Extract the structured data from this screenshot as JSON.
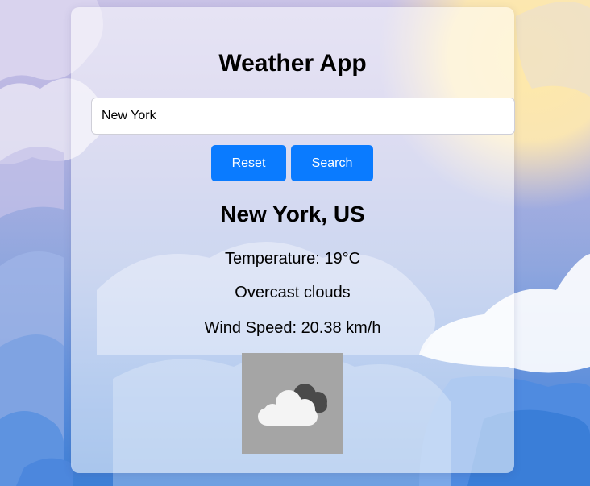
{
  "app": {
    "title": "Weather App"
  },
  "search": {
    "value": "New York"
  },
  "buttons": {
    "reset_label": "Reset",
    "search_label": "Search"
  },
  "weather": {
    "location": "New York, US",
    "temperature_label": "Temperature:",
    "temperature_value": "19°C",
    "description": "Overcast clouds",
    "wind_label": "Wind Speed:",
    "wind_value": "20.38 km/h",
    "icon": "overcast-clouds-icon"
  },
  "colors": {
    "button": "#0a7bff",
    "icon_background": "#a5a5a5"
  }
}
